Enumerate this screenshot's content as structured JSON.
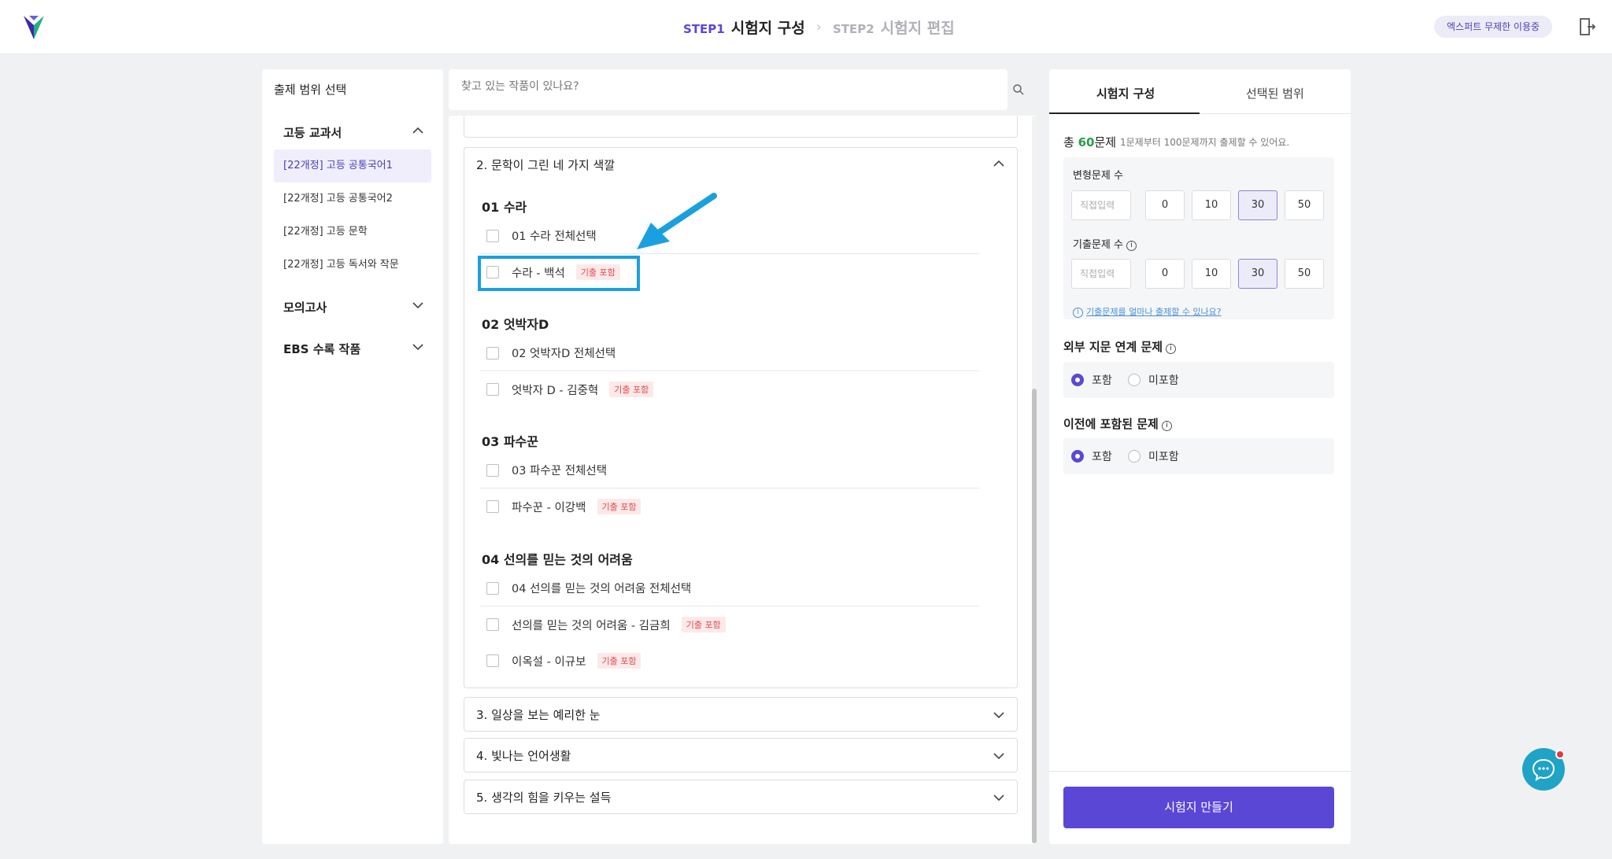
{
  "header": {
    "step1_num": "STEP1",
    "step1_title": "시험지 구성",
    "step2_num": "STEP2",
    "step2_title": "시험지 편집",
    "expert_badge": "엑스퍼트 무제한 이용중"
  },
  "sidebar": {
    "title": "출제 범위 선택",
    "categories": [
      {
        "label": "고등 교과서"
      },
      {
        "label": "모의고사"
      },
      {
        "label": "EBS 수록 작품"
      }
    ],
    "items": [
      {
        "label": "[22개정] 고등 공통국어1"
      },
      {
        "label": "[22개정] 고등 공통국어2"
      },
      {
        "label": "[22개정] 고등 문학"
      },
      {
        "label": "[22개정] 고등 독서와 작문"
      }
    ]
  },
  "search": {
    "placeholder": "찾고 있는 작품이 있나요?"
  },
  "sections": {
    "s2": "2. 문학이 그린 네 가지 색깔",
    "s3": "3. 일상을 보는 예리한 눈",
    "s4": "4. 빛나는 언어생활",
    "s5": "5. 생각의 힘을 키우는 설득"
  },
  "units": [
    {
      "title": "01 수라",
      "select_all": "01 수라 전체선택",
      "works": [
        {
          "label": "수라 - 백석",
          "tag": "기출 포함"
        }
      ]
    },
    {
      "title": "02 엇박자D",
      "select_all": "02 엇박자D 전체선택",
      "works": [
        {
          "label": "엇박자 D - 김중혁",
          "tag": "기출 포함"
        }
      ]
    },
    {
      "title": "03 파수꾼",
      "select_all": "03 파수꾼 전체선택",
      "works": [
        {
          "label": "파수꾼 - 이강백",
          "tag": "기출 포함"
        }
      ]
    },
    {
      "title": "04 선의를 믿는 것의 어려움",
      "select_all": "04 선의를 믿는 것의 어려움 전체선택",
      "works": [
        {
          "label": "선의를 믿는 것의 어려움 - 김금희",
          "tag": "기출 포함"
        },
        {
          "label": "이옥설 - 이규보",
          "tag": "기출 포함"
        }
      ]
    }
  ],
  "right": {
    "tab_compose": "시험지 구성",
    "tab_range": "선택된 범위",
    "total_prefix": "총",
    "total_count": "60",
    "total_suffix": "문제",
    "total_hint": "1문제부터 100문제까지 출제할 수 있어요.",
    "variant_label": "변형문제 수",
    "past_label": "기출문제 수",
    "direct_input": "직접입력",
    "count_options": [
      "0",
      "10",
      "30",
      "50"
    ],
    "variant_selected": "30",
    "past_selected": "30",
    "past_link": "기출문제를 얼마나 출제할 수 있나요?",
    "external_title": "외부 지문 연계 문제",
    "previous_title": "이전에 포함된 문제",
    "include": "포함",
    "exclude": "미포함",
    "external_selected": "포함",
    "previous_selected": "포함",
    "make_button": "시험지 만들기"
  },
  "colors": {
    "accent": "#5b47d6",
    "highlight": "#1aa0e0",
    "tag_red": "#e24a4a",
    "count_green": "#2a9d4b"
  }
}
